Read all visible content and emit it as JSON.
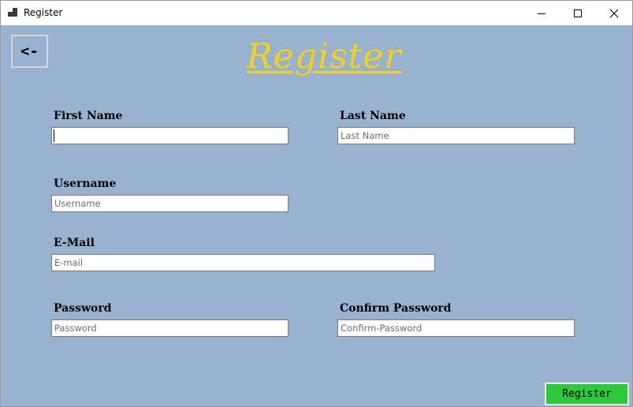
{
  "window": {
    "title": "Register",
    "controls": {
      "minimize": "minimize-icon",
      "maximize": "maximize-icon",
      "close": "close-icon"
    }
  },
  "form": {
    "back_label": "<-",
    "heading": "Register",
    "first_name": {
      "label": "First Name",
      "value": "",
      "placeholder": ""
    },
    "last_name": {
      "label": "Last Name",
      "value": "",
      "placeholder": "Last Name"
    },
    "username": {
      "label": "Username",
      "value": "",
      "placeholder": "Username"
    },
    "email": {
      "label": "E-Mail",
      "value": "",
      "placeholder": "E-mail"
    },
    "password": {
      "label": "Password",
      "value": "",
      "placeholder": "Password"
    },
    "confirm_password": {
      "label": "Confirm Password",
      "value": "",
      "placeholder": "Confirm-Password"
    },
    "submit_label": "Register"
  },
  "colors": {
    "background": "#98b2d0",
    "heading": "#f4d11a",
    "submit": "#2ec83a"
  }
}
